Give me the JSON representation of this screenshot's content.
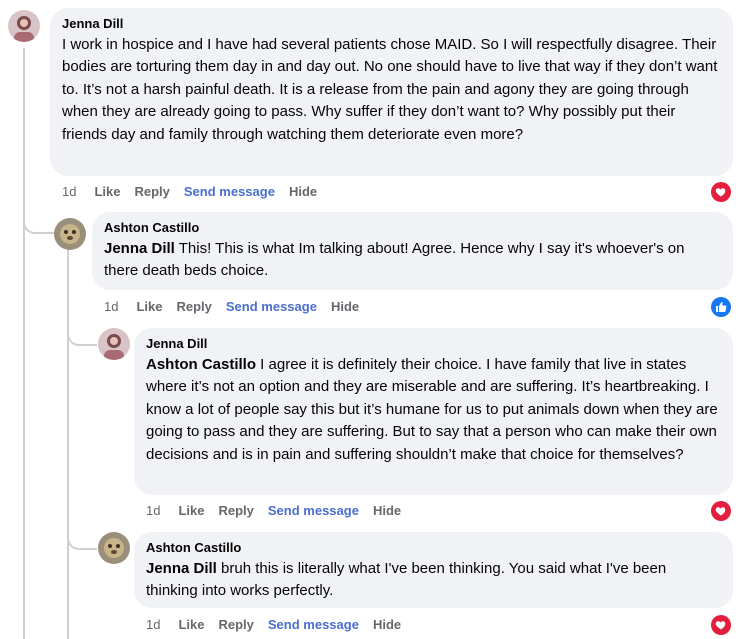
{
  "comments": [
    {
      "author": "Jenna Dill",
      "mention": "",
      "text": "I work in hospice and I have had several patients chose MAID. So I will respectfully disagree. Their bodies are torturing them day in and day out. No one should have to live that way if they don’t want to. It’s not a harsh painful death. It is a release from the pain and agony they are going through when they are already going to pass. Why suffer if they don’t want to? Why possibly put their friends day and family through watching them deteriorate even more?",
      "time": "1d",
      "like": "Like",
      "reply": "Reply",
      "send": "Send message",
      "hide": "Hide",
      "reaction": "heart"
    },
    {
      "author": "Ashton Castillo",
      "mention": "Jenna Dill",
      "text": " This! This is what Im talking about! Agree. Hence why I say it's whoever's on there death beds choice.",
      "time": "1d",
      "like": "Like",
      "reply": "Reply",
      "send": "Send message",
      "hide": "Hide",
      "reaction": "like"
    },
    {
      "author": "Jenna Dill",
      "mention": "Ashton Castillo",
      "text": " I agree it is definitely their choice. I have family that live in states where it’s not an option and they are miserable and are suffering. It’s heartbreaking. I know a lot of people say this but it’s humane for us to put animals down when they are going to pass and they are suffering. But to say that a person who can make their own decisions and is in pain and suffering shouldn’t make that choice for themselves?",
      "time": "1d",
      "like": "Like",
      "reply": "Reply",
      "send": "Send message",
      "hide": "Hide",
      "reaction": "heart"
    },
    {
      "author": "Ashton Castillo",
      "mention": "Jenna Dill",
      "text": " bruh this is literally what I've been thinking. You said what I've been thinking into works perfectly.",
      "time": "1d",
      "like": "Like",
      "reply": "Reply",
      "send": "Send message",
      "hide": "Hide",
      "reaction": "heart"
    }
  ],
  "colors": {
    "bubble": "#f0f2f5",
    "link": "#4b6ecf",
    "heart": "#e41e3f",
    "like": "#1877f2",
    "meta": "#65676b"
  }
}
